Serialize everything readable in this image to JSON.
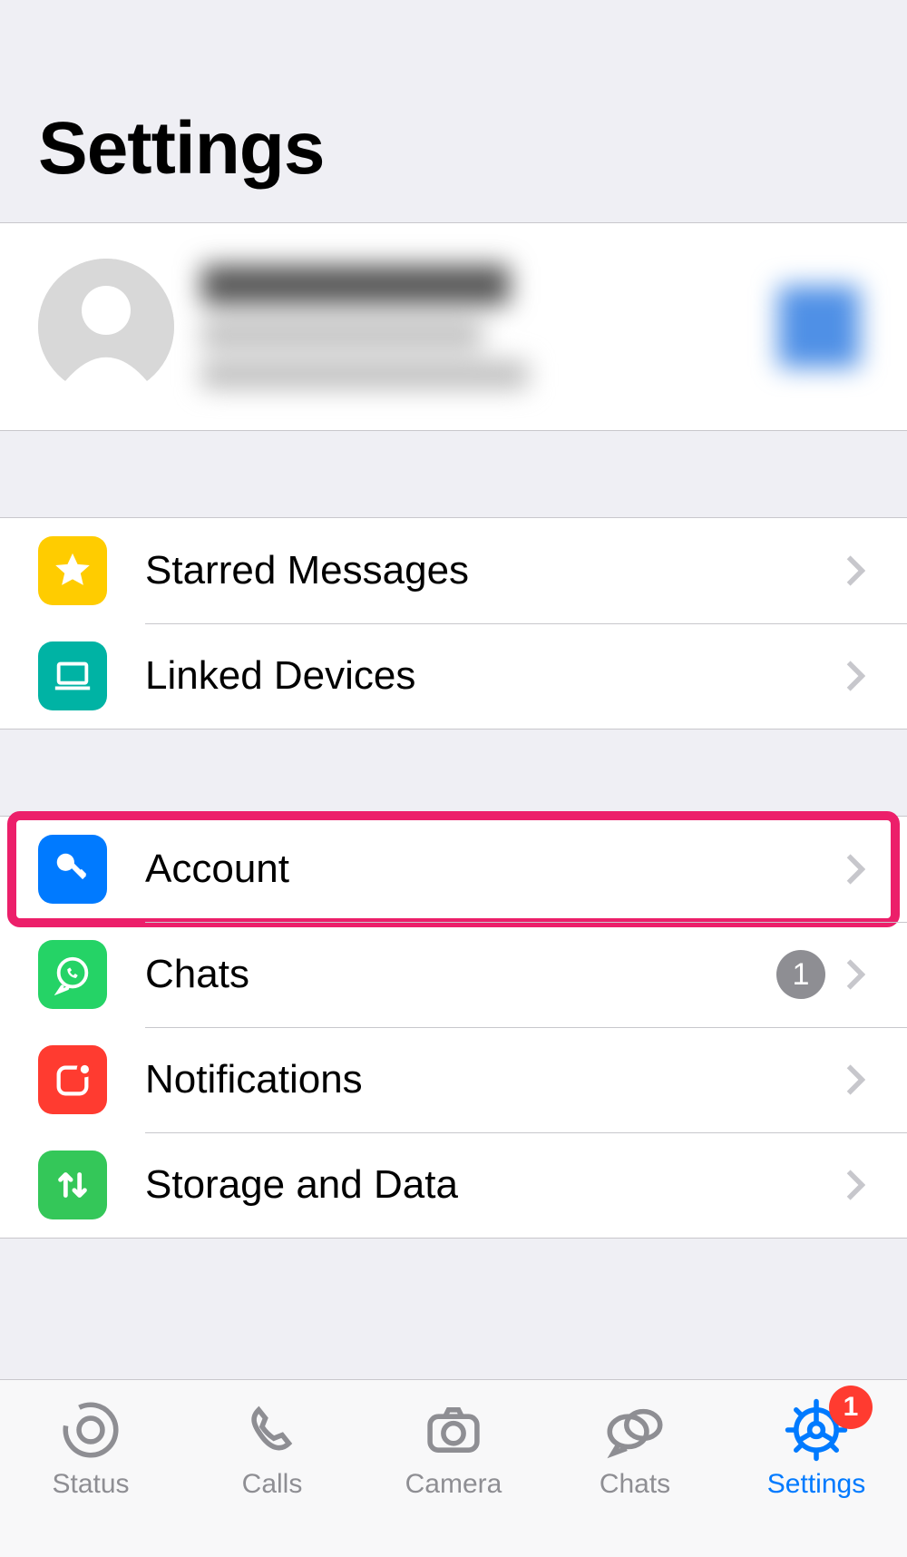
{
  "header": {
    "title": "Settings"
  },
  "profile": {
    "name_obscured": true,
    "status_obscured": true
  },
  "sections": {
    "group1": [
      {
        "id": "starred",
        "label": "Starred Messages",
        "icon": "star-icon",
        "color": "yellow"
      },
      {
        "id": "linked",
        "label": "Linked Devices",
        "icon": "laptop-icon",
        "color": "teal"
      }
    ],
    "group2": [
      {
        "id": "account",
        "label": "Account",
        "icon": "key-icon",
        "color": "blue",
        "highlighted": true
      },
      {
        "id": "chats",
        "label": "Chats",
        "icon": "whatsapp-icon",
        "color": "green",
        "badge": "1"
      },
      {
        "id": "notifications",
        "label": "Notifications",
        "icon": "notification-icon",
        "color": "red"
      },
      {
        "id": "storage",
        "label": "Storage and Data",
        "icon": "arrows-icon",
        "color": "green2"
      }
    ]
  },
  "tabs": [
    {
      "id": "status",
      "label": "Status",
      "icon": "status-icon"
    },
    {
      "id": "calls",
      "label": "Calls",
      "icon": "phone-icon"
    },
    {
      "id": "camera",
      "label": "Camera",
      "icon": "camera-icon"
    },
    {
      "id": "chats",
      "label": "Chats",
      "icon": "chats-icon"
    },
    {
      "id": "settings",
      "label": "Settings",
      "icon": "gear-icon",
      "active": true,
      "badge": "1"
    }
  ]
}
